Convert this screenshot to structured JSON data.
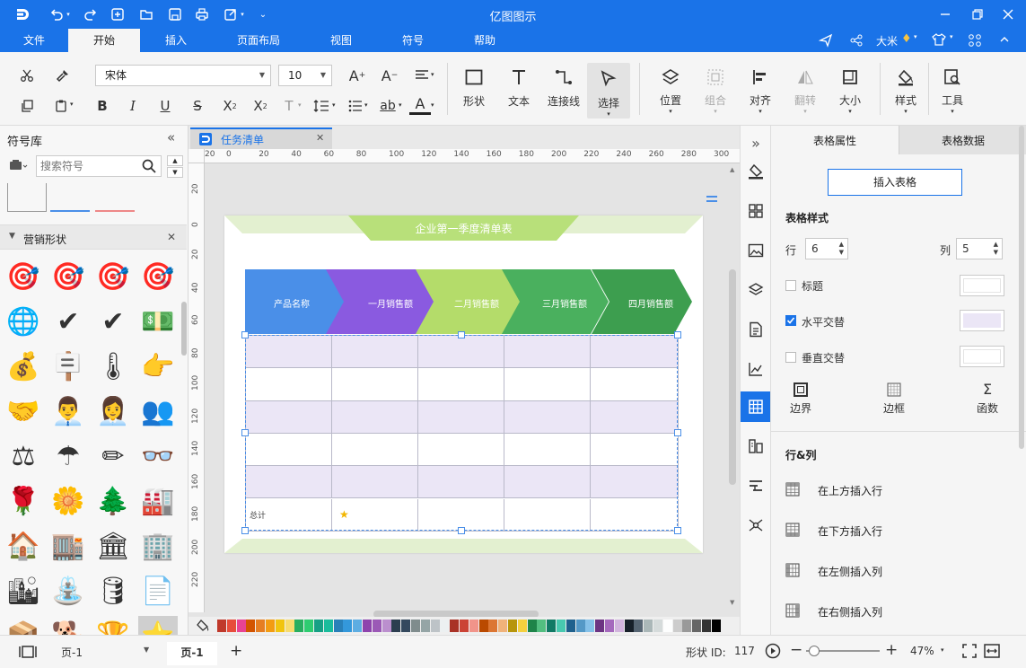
{
  "app": {
    "title": "亿图图示"
  },
  "menu": {
    "items": [
      "文件",
      "开始",
      "插入",
      "页面布局",
      "视图",
      "符号",
      "帮助"
    ],
    "active_index": 1
  },
  "user": {
    "name": "大米"
  },
  "ribbon": {
    "font_name": "宋体",
    "font_size": "10",
    "big_buttons": [
      {
        "label": "形状"
      },
      {
        "label": "文本"
      },
      {
        "label": "连接线"
      },
      {
        "label": "选择"
      },
      {
        "label": "位置"
      },
      {
        "label": "组合"
      },
      {
        "label": "对齐"
      },
      {
        "label": "翻转"
      },
      {
        "label": "大小"
      },
      {
        "label": "样式"
      },
      {
        "label": "工具"
      }
    ]
  },
  "library": {
    "title": "符号库",
    "search_placeholder": "搜索符号",
    "section": "营销形状",
    "symbols": [
      "🎯",
      "🎯",
      "🎯",
      "🎯",
      "🌐",
      "✔",
      "✔",
      "💵",
      "💰",
      "🪧",
      "🌡",
      "👉",
      "🤝",
      "👨‍💼",
      "👩‍💼",
      "👥",
      "⚖",
      "☂",
      "✏",
      "👓",
      "🌹",
      "🌼",
      "🌲",
      "🏭",
      "🏠",
      "🏬",
      "🏛",
      "🏢",
      "🏙",
      "⛲",
      "🛢",
      "📄",
      "📦",
      "🐕",
      "🏆",
      "⭐"
    ]
  },
  "document": {
    "tab_title": "任务清单"
  },
  "ruler": {
    "h": [
      "0",
      "20",
      "40",
      "60",
      "80",
      "100",
      "120",
      "140",
      "160",
      "180",
      "200",
      "220",
      "240",
      "260",
      "280",
      "300"
    ],
    "h_neg": "20",
    "v": [
      "20",
      "0",
      "20",
      "40",
      "60",
      "80",
      "100",
      "120",
      "140",
      "160",
      "180",
      "200",
      "220"
    ]
  },
  "sheet": {
    "title": "企业第一季度清单表",
    "headers": [
      "产品名称",
      "一月销售额",
      "二月销售额",
      "三月销售额",
      "四月销售额"
    ],
    "total_label": "总计"
  },
  "colors": {
    "accent": "#1a73e8",
    "header_blue": "#4a8fe8",
    "header_purple": "#8a5ae0",
    "header_lightgreen": "#b4dc6a",
    "header_green": "#4ab05e",
    "header_darkgreen": "#3d9e4f",
    "alt_row": "#ebe6f6",
    "title_banner": "#b8e07a"
  },
  "panel": {
    "tabs": [
      "表格属性",
      "表格数据"
    ],
    "active_tab": 0,
    "insert_table": "插入表格",
    "style_heading": "表格样式",
    "rows_label": "行",
    "rows_value": "6",
    "cols_label": "列",
    "cols_value": "5",
    "options": [
      {
        "label": "标题",
        "checked": false
      },
      {
        "label": "水平交替",
        "checked": true
      },
      {
        "label": "垂直交替",
        "checked": false
      }
    ],
    "tools": [
      "边界",
      "边框",
      "函数"
    ],
    "rows_cols_heading": "行&列",
    "actions": [
      "在上方插入行",
      "在下方插入行",
      "在左侧插入列",
      "在右侧插入列"
    ]
  },
  "status": {
    "page_select": "页-1",
    "page_tab": "页-1",
    "shape_id_label": "形状 ID:",
    "shape_id": "117",
    "zoom": "47%",
    "zoom_fraction": 0.47
  }
}
